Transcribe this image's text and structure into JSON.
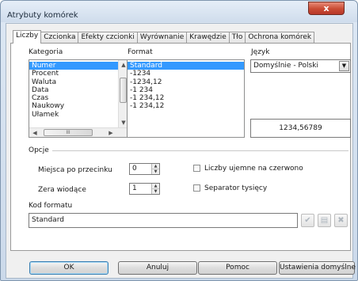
{
  "window": {
    "title": "Atrybuty komórek",
    "close_glyph": "x"
  },
  "tabs": [
    "Liczby",
    "Czcionka",
    "Efekty czcionki",
    "Wyrównanie",
    "Krawędzie",
    "Tło",
    "Ochrona komórek"
  ],
  "category": {
    "label": "Kategoria",
    "items": [
      "Numer",
      "Procent",
      "Waluta",
      "Data",
      "Czas",
      "Naukowy",
      "Ułamek"
    ],
    "selected": "Numer",
    "hscroll_thumb_glyph": "III"
  },
  "format": {
    "label": "Format",
    "items": [
      "Standard",
      "-1234",
      "-1234,12",
      "-1 234",
      "-1 234,12",
      "-1 234,12"
    ],
    "selected": "Standard"
  },
  "language": {
    "label": "Język",
    "value": "Domyślnie - Polski"
  },
  "preview": {
    "value": "1234,56789"
  },
  "options": {
    "label": "Opcje",
    "decimal_places": {
      "label": "Miejsca po przecinku",
      "value": "0"
    },
    "leading_zeros": {
      "label": "Zera wiodące",
      "value": "1"
    },
    "negative_red": {
      "label": "Liczby ujemne na czerwono",
      "checked": false
    },
    "thousands_sep": {
      "label": "Separator tysięcy",
      "checked": false
    }
  },
  "format_code": {
    "label": "Kod formatu",
    "value": "Standard"
  },
  "buttons": {
    "ok": "OK",
    "cancel": "Anuluj",
    "help": "Pomoc",
    "defaults": "Ustawienia domyślne"
  }
}
